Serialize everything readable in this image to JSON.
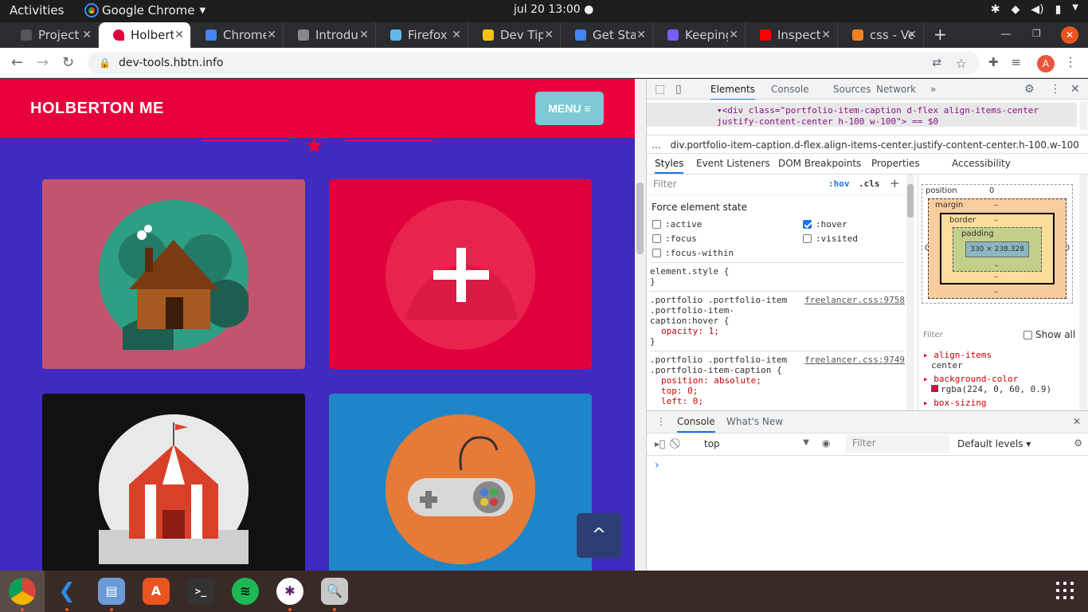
{
  "system": {
    "activities": "Activities",
    "app": "Google Chrome",
    "clock": "jul 20  13:00 ●"
  },
  "tabs": [
    {
      "title": "Project",
      "fav": "#555"
    },
    {
      "title": "Holberto",
      "fav": "#e0003c",
      "active": true
    },
    {
      "title": "Chrome",
      "fav": "#4285f4"
    },
    {
      "title": "Introdu",
      "fav": "#888"
    },
    {
      "title": "Firefox",
      "fav": "#5fb8e8"
    },
    {
      "title": "Dev Tip",
      "fav": "#f5c400"
    },
    {
      "title": "Get Sta",
      "fav": "#4285f4"
    },
    {
      "title": "Keeping",
      "fav": "#7c5cff"
    },
    {
      "title": "Inspect",
      "fav": "#ff0000"
    },
    {
      "title": "css - Ve",
      "fav": "#f48024"
    }
  ],
  "address": {
    "url": "dev-tools.hbtn.info",
    "avatar": "A"
  },
  "site": {
    "brand": "HOLBERTON ME",
    "menu_label": "MENU ≡",
    "scroll_top": "^",
    "cards": [
      {
        "bg": "#c25470",
        "circle": "#2e9e84",
        "icon": "cabin-icon"
      },
      {
        "bg": "#e0003c",
        "circle": "#e4103f",
        "icon": "cake-icon"
      },
      {
        "bg": "#111111",
        "circle": "#e9e9e9",
        "icon": "circus-tent-icon"
      },
      {
        "bg": "#1e86c8",
        "circle": "#e87a37",
        "icon": "game-controller-icon"
      }
    ]
  },
  "devtools": {
    "tabs": [
      "Elements",
      "Console",
      "Sources",
      "Network",
      "»"
    ],
    "element_line1": "▾<div class=\"portfolio-item-caption d-flex align-items-center",
    "element_line2": "justify-content-center h-100 w-100\"> == $0",
    "breadcrumb": "div.portfolio-item-caption.d-flex.align-items-center.justify-content-center.h-100.w-100",
    "subtabs": [
      "Styles",
      "Event Listeners",
      "DOM Breakpoints",
      "Properties",
      "Accessibility"
    ],
    "filter_placeholder": "Filter",
    "hov": ":hov",
    "cls": ".cls",
    "force_state_title": "Force element state",
    "states": {
      "active": ":active",
      "hover": ":hover",
      "focus": ":focus",
      "visited": ":visited",
      "focus_within": ":focus-within"
    },
    "rules": {
      "element_style_open": "element.style {",
      "element_style_close": "}",
      "rule1_sel1": ".portfolio .portfolio-item",
      "rule1_sel2": ".portfolio-item-",
      "rule1_sel3": "caption:hover {",
      "rule1_src": "freelancer.css:9758",
      "rule1_prop": "opacity: 1;",
      "rule1_close": "}",
      "rule2_sel1": ".portfolio .portfolio-item",
      "rule2_sel2": ".portfolio-item-caption {",
      "rule2_src": "freelancer.css:9749",
      "rule2_p1": "position: absolute;",
      "rule2_p2": "top: 0;",
      "rule2_p3": "left: 0;"
    },
    "boxmodel": {
      "position": "position",
      "pos_val": "0",
      "margin": "margin",
      "border": "border",
      "padding": "padding",
      "dash": "–",
      "content": "330 × 238.328",
      "zero": "0"
    },
    "computed_filter": "Filter",
    "show_all": "Show all",
    "computed": [
      {
        "prop": "align-items",
        "val": "center"
      },
      {
        "prop": "background-color",
        "val": "rgba(224, 0, 60, 0.9)"
      },
      {
        "prop": "box-sizing",
        "val": ""
      }
    ],
    "drawer_tabs": [
      "Console",
      "What's New"
    ],
    "context": "top",
    "console_filter": "Filter",
    "levels": "Default levels ▾",
    "prompt": "›"
  },
  "taskbar": [
    "Chrome",
    "VS Code",
    "Files",
    "Software",
    "Terminal",
    "Spotify",
    "Slack",
    "Screenshot",
    "Apps"
  ]
}
